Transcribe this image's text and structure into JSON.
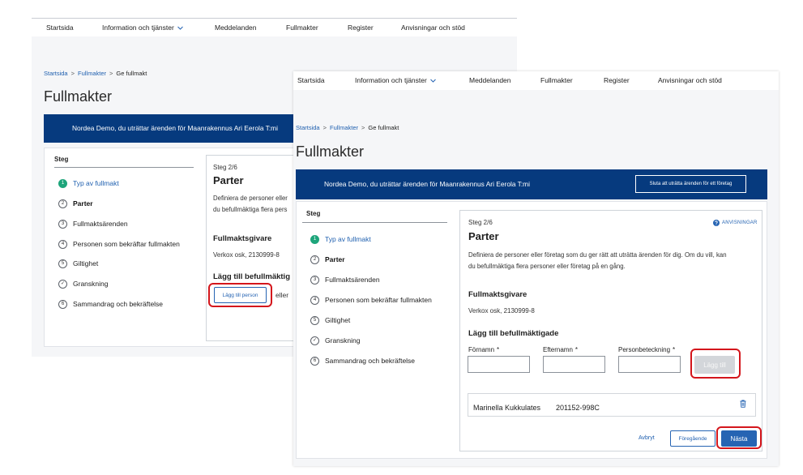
{
  "colors": {
    "banner": "#063a7e",
    "primary": "#2664b3",
    "link": "#2161b0",
    "done": "#1ea57b",
    "highlight": "#d4161c",
    "page": "#f5f6f8"
  },
  "back_screen": {
    "nav": [
      {
        "label": "Startsida"
      },
      {
        "label": "Information och tjänster",
        "icon": "chevron-down-icon"
      },
      {
        "label": "Meddelanden"
      },
      {
        "label": "Fullmakter"
      },
      {
        "label": "Register"
      },
      {
        "label": "Anvisningar och stöd"
      }
    ],
    "breadcrumb": {
      "items": [
        "Startsida",
        "Fullmakter"
      ],
      "separator": ">",
      "current": "Ge fullmakt"
    },
    "page_title": "Fullmakter",
    "banner_text": "Nordea Demo, du uträttar ärenden för Maanrakennus Ari Eerola T:mi",
    "steps_title": "Steg",
    "steps": [
      {
        "marker": "1",
        "label": "Typ av fullmakt"
      },
      {
        "marker": "2",
        "label": "Parter"
      },
      {
        "marker": "3",
        "label": "Fullmaktsärenden"
      },
      {
        "marker": "4",
        "label": "Personen som bekräftar fullmakten"
      },
      {
        "marker": "5",
        "label": "Giltighet"
      },
      {
        "marker": "✓",
        "label": "Granskning"
      },
      {
        "marker": "6",
        "label": "Sammandrag och bekräftelse"
      }
    ],
    "form": {
      "step_counter": "Steg 2/6",
      "title": "Parter",
      "intro": [
        "Definiera de personer eller",
        "du befullmäktiga flera pers"
      ],
      "grantor_heading": "Fullmaktsgivare",
      "grantor_value": "Verkox osk, 2130999-8",
      "add_heading": "Lägg till befullmäktig",
      "add_person_button": "Lägg till person",
      "or_text": "eller"
    }
  },
  "front_screen": {
    "nav": [
      {
        "label": "Startsida"
      },
      {
        "label": "Information och tjänster",
        "icon": "chevron-down-icon"
      },
      {
        "label": "Meddelanden"
      },
      {
        "label": "Fullmakter"
      },
      {
        "label": "Register"
      },
      {
        "label": "Anvisningar och stöd"
      }
    ],
    "breadcrumb": {
      "items": [
        "Startsida",
        "Fullmakter"
      ],
      "separator": ">",
      "current": "Ge fullmakt"
    },
    "page_title": "Fullmakter",
    "banner_text": "Nordea Demo, du uträttar ärenden för Maanrakennus Ari Eerola T:mi",
    "banner_button": "Sluta att uträtta ärenden för ett företag",
    "steps_title": "Steg",
    "steps": [
      {
        "marker": "1",
        "label": "Typ av fullmakt"
      },
      {
        "marker": "2",
        "label": "Parter"
      },
      {
        "marker": "3",
        "label": "Fullmaktsärenden"
      },
      {
        "marker": "4",
        "label": "Personen som bekräftar fullmakten"
      },
      {
        "marker": "5",
        "label": "Giltighet"
      },
      {
        "marker": "✓",
        "label": "Granskning"
      },
      {
        "marker": "6",
        "label": "Sammandrag och bekräftelse"
      }
    ],
    "form": {
      "step_counter": "Steg 2/6",
      "help_icon": "question-circle-icon",
      "help_link": "ANVISNINGAR",
      "title": "Parter",
      "intro": [
        "Definiera de personer eller företag som du ger rätt att uträtta ärenden för dig. Om du vill, kan",
        "du befullmäktiga flera personer eller företag på en gång."
      ],
      "grantor_heading": "Fullmaktsgivare",
      "grantor_value": "Verkox osk, 2130999-8",
      "add_heading": "Lägg till befullmäktigade",
      "fields": [
        {
          "label": "Förnamn",
          "required": "*",
          "value": ""
        },
        {
          "label": "Efternamn",
          "required": "*",
          "value": ""
        },
        {
          "label": "Personbeteckning",
          "required": "*",
          "value": ""
        }
      ],
      "add_button": "Lägg till",
      "added_persons": [
        {
          "name": "Marinella Kukkulates",
          "id": "201152-998C",
          "icon": "trash-icon"
        }
      ],
      "cancel": "Avbryt",
      "previous": "Föregående",
      "next": "Nästa"
    }
  }
}
